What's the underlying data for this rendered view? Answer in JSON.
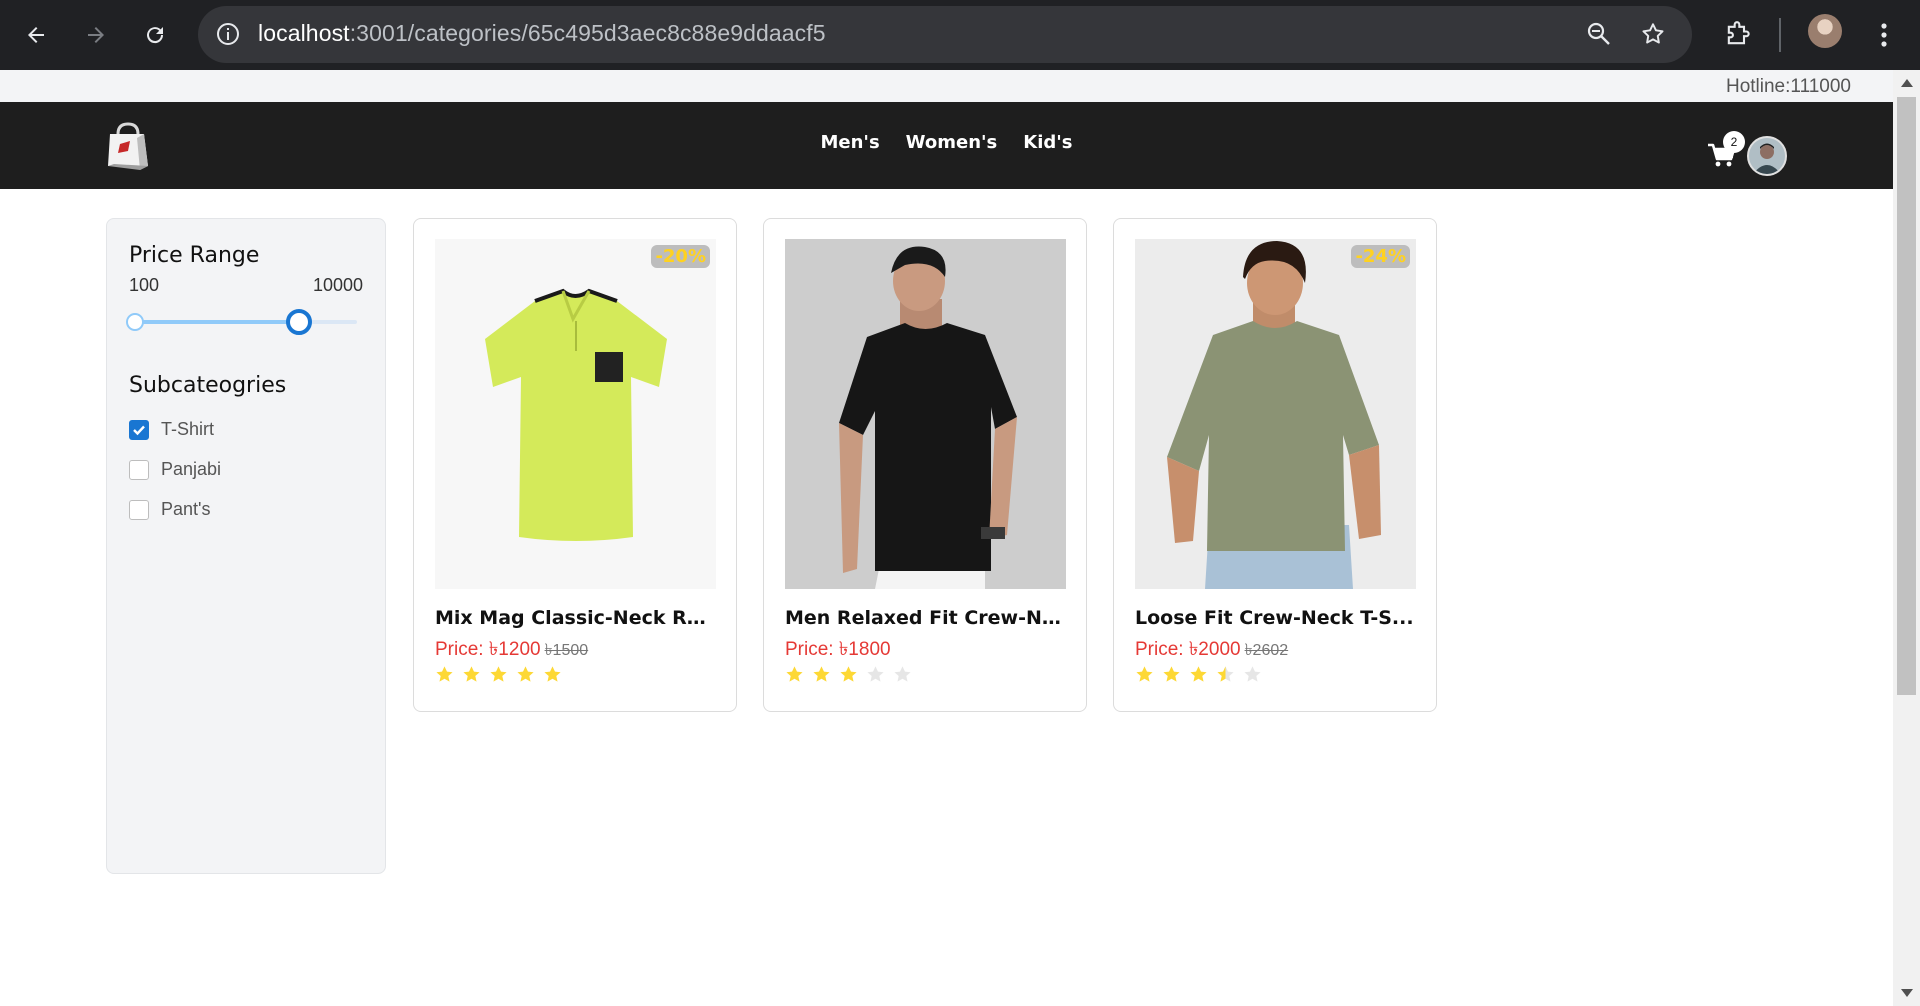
{
  "browser": {
    "url_host": "localhost",
    "url_path": ":3001/categories/65c495d3aec8c88e9ddaacf5"
  },
  "topbar": {
    "hotline": "Hotline:111000"
  },
  "nav": {
    "links": [
      "Men's",
      "Women's",
      "Kid's"
    ],
    "cart_count": "2"
  },
  "sidebar": {
    "price_title": "Price Range",
    "price_min": "100",
    "price_max": "10000",
    "slider_fill_fraction": 0.74,
    "subcat_title": "Subcateogries",
    "subcategories": [
      {
        "label": "T-Shirt",
        "checked": true
      },
      {
        "label": "Panjabi",
        "checked": false
      },
      {
        "label": "Pant's",
        "checked": false
      }
    ]
  },
  "products": [
    {
      "title": "Mix Mag Classic-Neck Re...",
      "price_label": "Price: ৳1200",
      "old_price": "৳1500",
      "discount": "-20%",
      "rating": 5,
      "image": "yellow-polo-shirt"
    },
    {
      "title": "Men Relaxed Fit Crew-Ne...",
      "price_label": "Price: ৳1800",
      "old_price": "",
      "discount": "",
      "rating": 3,
      "image": "man-black-tshirt"
    },
    {
      "title": "Loose Fit Crew-Neck T-S...",
      "price_label": "Price: ৳2000",
      "old_price": "৳2602",
      "discount": "-24%",
      "rating": 3.5,
      "image": "man-olive-tshirt"
    }
  ],
  "colors": {
    "accent": "#1976d2",
    "price": "#e53935",
    "star": "#fdd835",
    "star_empty": "#e6e6e6",
    "nav_bg": "#1e1e1e"
  }
}
